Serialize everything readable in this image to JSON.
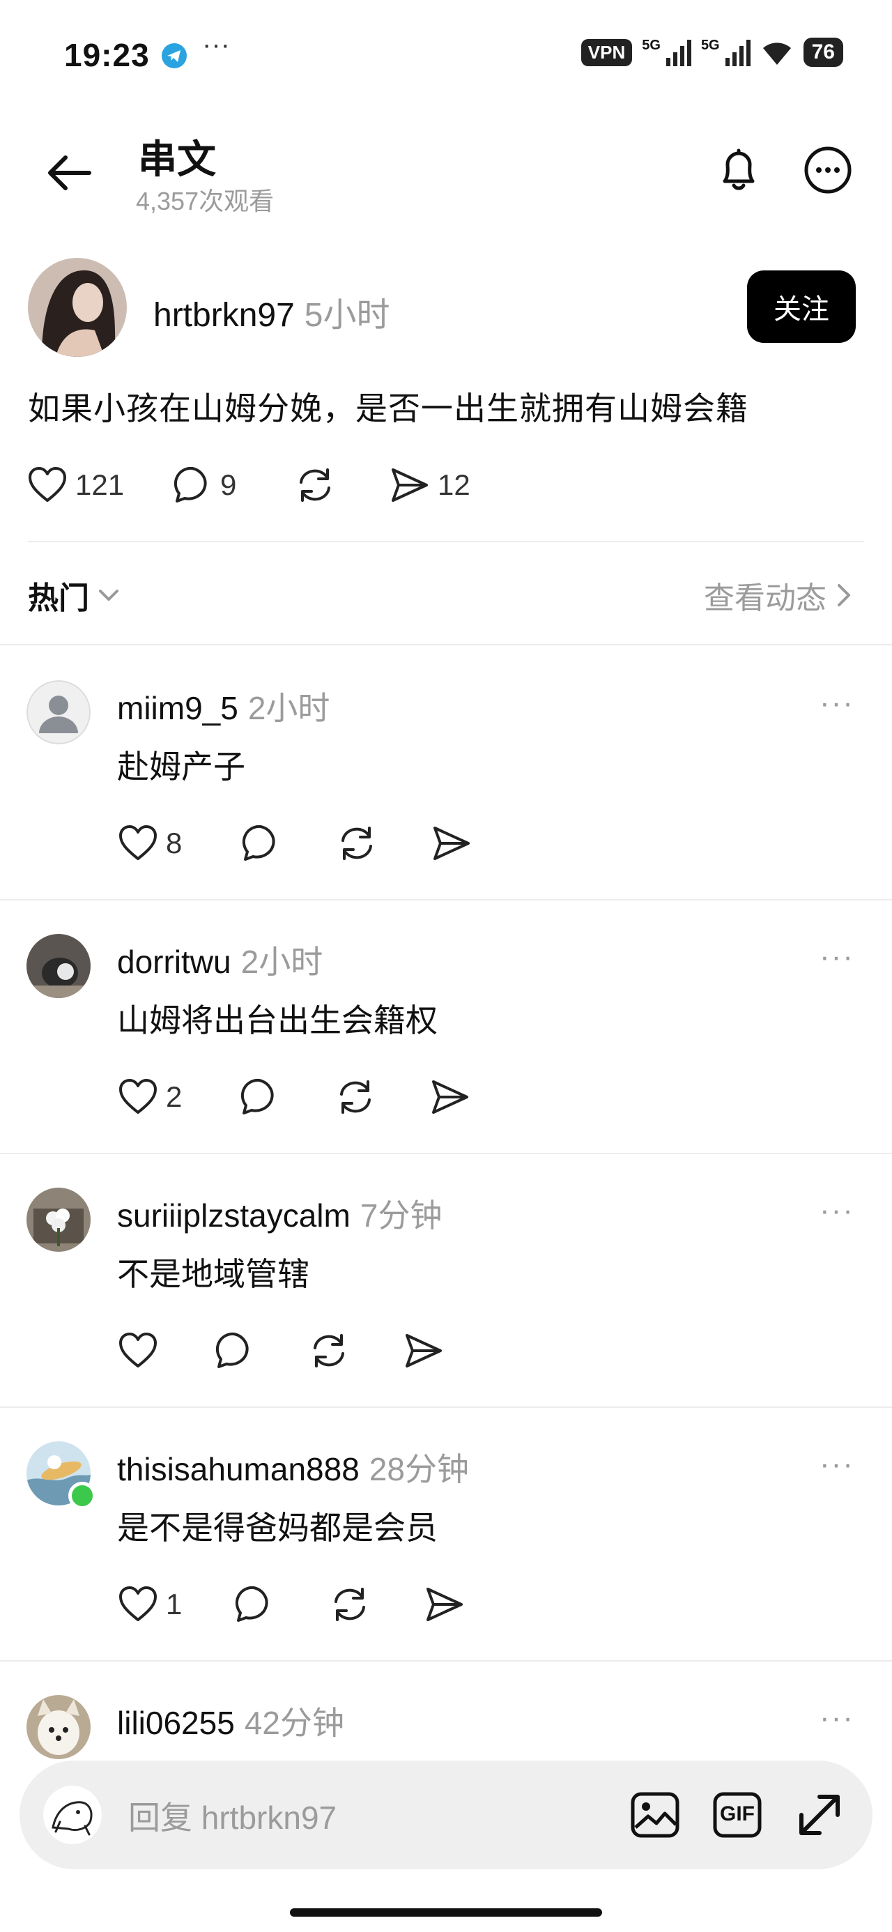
{
  "status_bar": {
    "time": "19:23",
    "extra": "···",
    "vpn": "VPN",
    "net1": "5G",
    "net2": "5G",
    "battery": "76"
  },
  "header": {
    "title": "串文",
    "views": "4,357次观看"
  },
  "post": {
    "username": "hrtbrkn97",
    "time": "5小时",
    "follow_label": "关注",
    "text": "如果小孩在山姆分娩，是否一出生就拥有山姆会籍",
    "likes": "121",
    "comments": "9",
    "shares": "12"
  },
  "sort": {
    "label": "热门",
    "activity_link": "查看动态"
  },
  "replies": [
    {
      "username": "miim9_5",
      "time": "2小时",
      "text": "赴姆产子",
      "likes": "8"
    },
    {
      "username": "dorritwu",
      "time": "2小时",
      "text": "山姆将出台出生会籍权",
      "likes": "2"
    },
    {
      "username": "suriiiplzstaycalm",
      "time": "7分钟",
      "text": "不是地域管辖",
      "likes": ""
    },
    {
      "username": "thisisahuman888",
      "time": "28分钟",
      "text": "是不是得爸妈都是会员",
      "likes": "1"
    },
    {
      "username": "lili06255",
      "time": "42分钟",
      "text": "",
      "likes": ""
    }
  ],
  "composer": {
    "placeholder": "回复 hrtbrkn97",
    "gif_label": "GIF"
  },
  "colors": {
    "accent": "#000000",
    "muted_text": "#9b9b9b",
    "online_dot": "#3cc84a",
    "composer_bg": "#efefef"
  }
}
